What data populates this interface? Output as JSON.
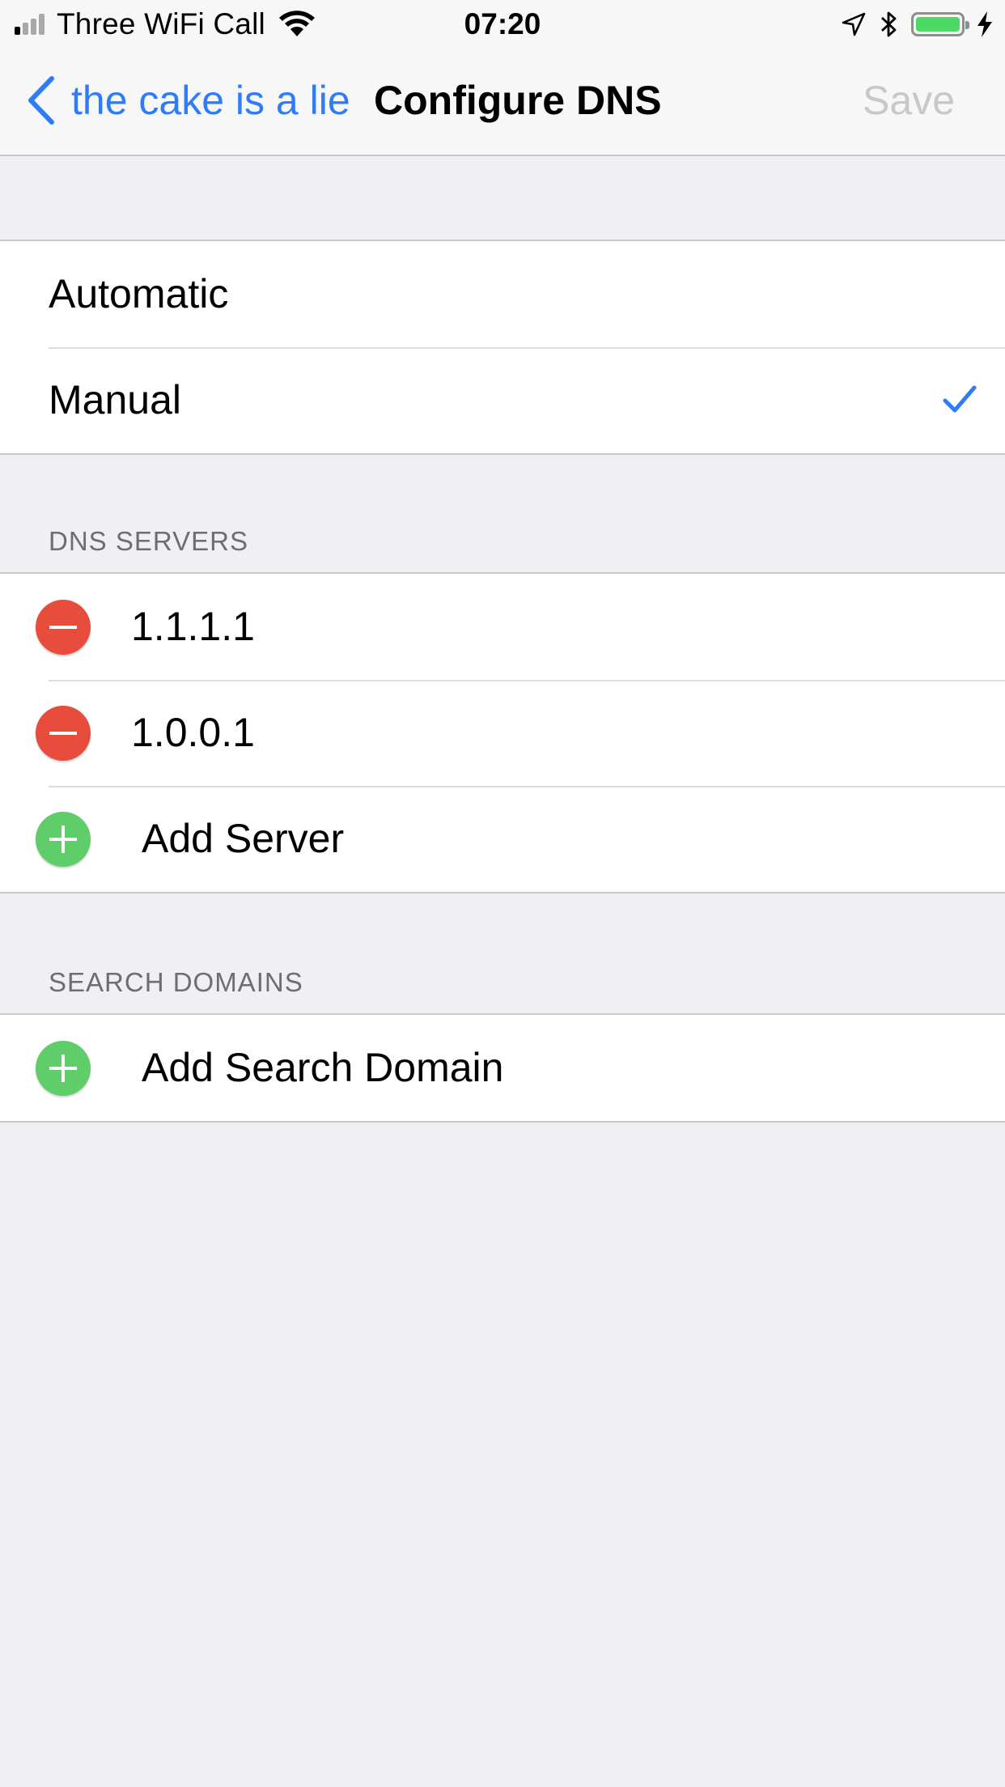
{
  "status_bar": {
    "carrier": "Three WiFi Call",
    "time": "07:20",
    "signal_bars_active": 1,
    "signal_bars_total": 4,
    "battery_level": 1.0,
    "battery_color": "#4cd964"
  },
  "nav": {
    "back_label": "the cake is a lie",
    "title": "Configure DNS",
    "save_label": "Save"
  },
  "mode": {
    "options": [
      "Automatic",
      "Manual"
    ],
    "selected": "Manual"
  },
  "dns_servers": {
    "header": "DNS SERVERS",
    "servers": [
      "1.1.1.1",
      "1.0.0.1"
    ],
    "add_label": "Add Server"
  },
  "search_domains": {
    "header": "SEARCH DOMAINS",
    "add_label": "Add Search Domain"
  },
  "colors": {
    "accent": "#2f7cf6",
    "delete": "#e74c3c",
    "add": "#5fcd6a",
    "background": "#efeff4"
  }
}
